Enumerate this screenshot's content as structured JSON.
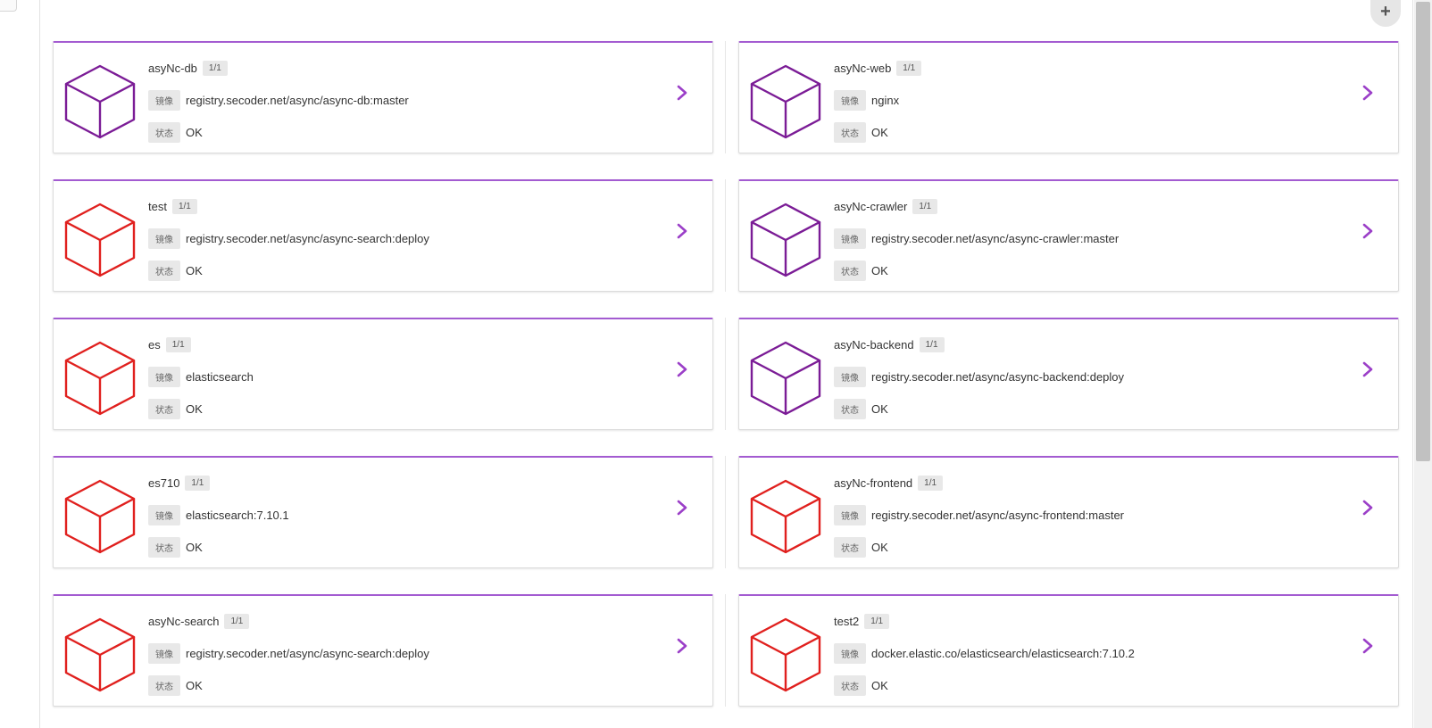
{
  "page": {
    "add_label": "+",
    "tag_image": "镜像",
    "tag_status": "状态"
  },
  "colors": {
    "purple": "#7b1c96",
    "red": "#e0201e",
    "accent": "#a35bd1",
    "chevron": "#9b3fc8"
  },
  "services": [
    {
      "name": "asyNc-db",
      "replicas": "1/1",
      "image": "registry.secoder.net/async/async-db:master",
      "status": "OK",
      "icon": "cube-icon",
      "icon_color": "purple"
    },
    {
      "name": "asyNc-web",
      "replicas": "1/1",
      "image": "nginx",
      "status": "OK",
      "icon": "cube-icon",
      "icon_color": "purple"
    },
    {
      "name": "test",
      "replicas": "1/1",
      "image": "registry.secoder.net/async/async-search:deploy",
      "status": "OK",
      "icon": "cube-icon",
      "icon_color": "red"
    },
    {
      "name": "asyNc-crawler",
      "replicas": "1/1",
      "image": "registry.secoder.net/async/async-crawler:master",
      "status": "OK",
      "icon": "cube-icon",
      "icon_color": "purple"
    },
    {
      "name": "es",
      "replicas": "1/1",
      "image": "elasticsearch",
      "status": "OK",
      "icon": "cube-icon",
      "icon_color": "red"
    },
    {
      "name": "asyNc-backend",
      "replicas": "1/1",
      "image": "registry.secoder.net/async/async-backend:deploy",
      "status": "OK",
      "icon": "cube-icon",
      "icon_color": "purple"
    },
    {
      "name": "es710",
      "replicas": "1/1",
      "image": "elasticsearch:7.10.1",
      "status": "OK",
      "icon": "cube-icon",
      "icon_color": "red"
    },
    {
      "name": "asyNc-frontend",
      "replicas": "1/1",
      "image": "registry.secoder.net/async/async-frontend:master",
      "status": "OK",
      "icon": "cube-icon",
      "icon_color": "red"
    },
    {
      "name": "asyNc-search",
      "replicas": "1/1",
      "image": "registry.secoder.net/async/async-search:deploy",
      "status": "OK",
      "icon": "cube-icon",
      "icon_color": "red"
    },
    {
      "name": "test2",
      "replicas": "1/1",
      "image": "docker.elastic.co/elasticsearch/elasticsearch:7.10.2",
      "status": "OK",
      "icon": "cube-icon",
      "icon_color": "red"
    }
  ]
}
